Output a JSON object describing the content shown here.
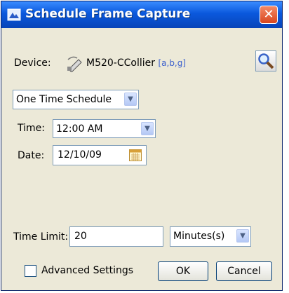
{
  "window": {
    "title": "Schedule Frame Capture",
    "close_label": "✕"
  },
  "device": {
    "label": "Device:",
    "name": "M520-CCollier",
    "protocols": "[a,b,g]"
  },
  "schedule": {
    "selected": "One Time Schedule"
  },
  "time": {
    "label": "Time:",
    "value": "12:00 AM"
  },
  "date": {
    "label": "Date:",
    "value": "12/10/09"
  },
  "time_limit": {
    "label": "Time Limit:",
    "value": "20",
    "unit": "Minutes(s)"
  },
  "advanced": {
    "label": "Advanced Settings",
    "checked": false
  },
  "buttons": {
    "ok": "OK",
    "cancel": "Cancel"
  }
}
